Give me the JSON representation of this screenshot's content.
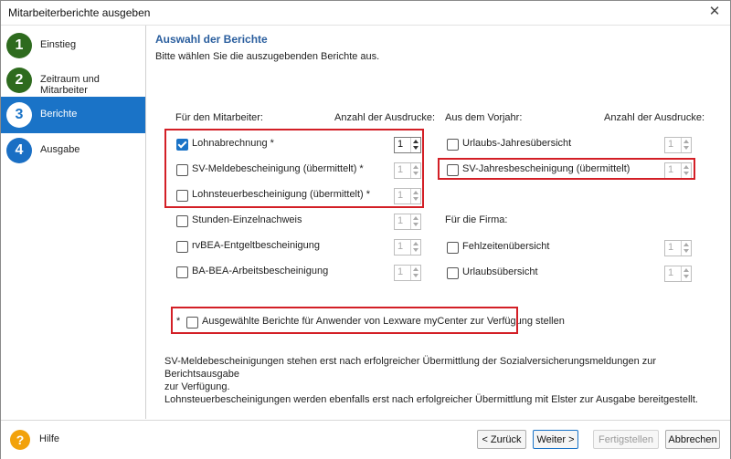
{
  "window": {
    "title": "Mitarbeiterberichte ausgeben",
    "close_glyph": "✕"
  },
  "steps": [
    {
      "num": "1",
      "label": "Einstieg",
      "state": "done"
    },
    {
      "num": "2",
      "label": "Zeitraum und Mitarbeiter",
      "state": "done"
    },
    {
      "num": "3",
      "label": "Berichte",
      "state": "active"
    },
    {
      "num": "4",
      "label": "Ausgabe",
      "state": "todo"
    }
  ],
  "header": {
    "title": "Auswahl der Berichte",
    "subtitle": "Bitte wählen Sie die auszugebenden Berichte aus."
  },
  "left": {
    "heading": "Für den Mitarbeiter:",
    "count_heading": "Anzahl der Ausdrucke:",
    "items": [
      {
        "label": "Lohnabrechnung *",
        "checked": true,
        "count": "1"
      },
      {
        "label": "SV-Meldebescheinigung (übermittelt) *",
        "checked": false,
        "count": "1"
      },
      {
        "label": "Lohnsteuerbescheinigung (übermittelt) *",
        "checked": false,
        "count": "1"
      },
      {
        "label": "Stunden-Einzelnachweis",
        "checked": false,
        "count": "1"
      },
      {
        "label": "rvBEA-Entgeltbescheinigung",
        "checked": false,
        "count": "1"
      },
      {
        "label": "BA-BEA-Arbeitsbescheinigung",
        "checked": false,
        "count": "1"
      }
    ]
  },
  "right": {
    "heading": "Aus dem Vorjahr:",
    "count_heading": "Anzahl der Ausdrucke:",
    "items": [
      {
        "label": "Urlaubs-Jahresübersicht",
        "checked": false,
        "count": "1"
      },
      {
        "label": "SV-Jahresbescheinigung (übermittelt)",
        "checked": false,
        "count": "1"
      }
    ],
    "firm_heading": "Für die Firma:",
    "firm_items": [
      {
        "label": "Fehlzeitenübersicht",
        "checked": false,
        "count": "1"
      },
      {
        "label": "Urlaubsübersicht",
        "checked": false,
        "count": "1"
      }
    ]
  },
  "mycenter": {
    "star": "*",
    "label": "Ausgewählte Berichte für Anwender von Lexware myCenter zur Verfügung stellen",
    "checked": false
  },
  "notes": {
    "line1": "SV-Meldebescheinigungen stehen erst nach erfolgreicher Übermittlung der Sozialversicherungsmeldungen zur Berichtsausgabe",
    "line2": "zur Verfügung.",
    "line3": "Lohnsteuerbescheinigungen werden ebenfalls erst nach erfolgreicher Übermittlung mit Elster zur Ausgabe bereitgestellt."
  },
  "footer": {
    "help_glyph": "?",
    "help_label": "Hilfe",
    "back": "< Zurück",
    "next": "Weiter >",
    "finish": "Fertigstellen",
    "cancel": "Abbrechen"
  },
  "colors": {
    "accent": "#1a73c7",
    "done": "#2e6b1e",
    "highlight": "#d31f26",
    "help": "#f2a20c"
  }
}
